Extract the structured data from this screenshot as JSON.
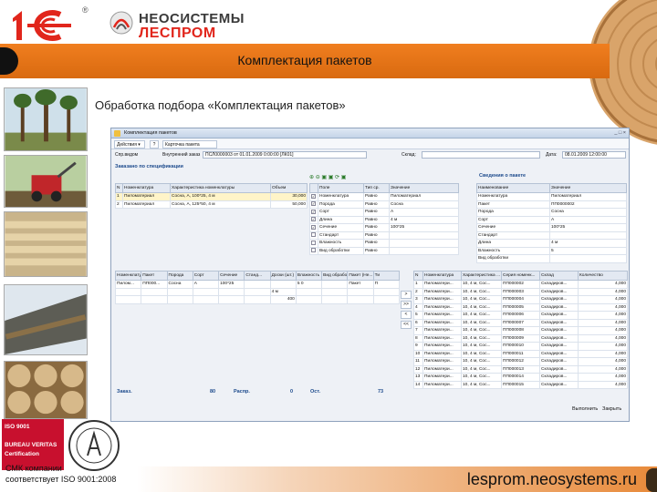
{
  "slide": {
    "title": "Комплектация пакетов",
    "subtitle": "Обработка подбора «Комплектация пакетов»",
    "reg_mark": "®",
    "company_line1": "НЕОСИСТЕМЫ",
    "company_line2": "ЛЕСПРОМ",
    "cert_line1": "ISO 9001",
    "cert_line2": "BUREAU VERITAS",
    "cert_line3": "Certification",
    "smk_line1": "СМК компании",
    "smk_line2": "соответствует ISO 9001:2008",
    "site": "lesprom.neosystems.ru",
    "accent": "#f07e1f",
    "logo_red": "#e1261c"
  },
  "app": {
    "window_title": "Комплектация пакетов",
    "toolbar": {
      "actions": "Действия ▾",
      "help": "?",
      "card": "Карточка пакета"
    },
    "filter": {
      "label": "Спр.видом",
      "doc_label": "Внутренний заказ",
      "doc_value": "ПСЛ0000003 от 01.01.2009 0:00:00 [ЛК01]",
      "warehouse_label": "Склад:",
      "date_label": "Дата:",
      "date_value": "08.01.2009 12:00:00"
    },
    "spec_title": "Заказано по спецификации",
    "spec_columns": [
      "N",
      "Номенклатура",
      "Характеристика номенклатуры",
      "Объем"
    ],
    "spec_rows": [
      [
        "1",
        "Пиломатериал",
        "Сосна, А, 100*25, 4 м",
        "30,000"
      ],
      [
        "2",
        "Пиломатериал",
        "Сосна, А, 125*50, 4 м",
        "50,000"
      ]
    ],
    "filter_columns": [
      "",
      "Поле",
      "Тип ср.",
      "Значение"
    ],
    "filter_rows": [
      [
        "✓",
        "Номенклатура",
        "Равно",
        "Пиломатериал"
      ],
      [
        "✓",
        "Порода",
        "Равно",
        "Сосна"
      ],
      [
        "✓",
        "Сорт",
        "Равно",
        "А"
      ],
      [
        "✓",
        "Длина",
        "Равно",
        "4 м"
      ],
      [
        "✓",
        "Сечение",
        "Равно",
        "100*25"
      ],
      [
        "",
        "Стандарт",
        "Равно",
        ""
      ],
      [
        "",
        "Влажность",
        "Равно",
        ""
      ],
      [
        "",
        "Вид обработки",
        "Равно",
        ""
      ]
    ],
    "pack_title": "Сведения о пакете",
    "pack_columns": [
      "Наименование",
      "Значение"
    ],
    "pack_rows": [
      [
        "Номенклатура",
        "Пиломатериал"
      ],
      [
        "Пакет",
        "ПП0000002"
      ],
      [
        "Порода",
        "Сосна"
      ],
      [
        "Сорт",
        "А"
      ],
      [
        "Сечение",
        "100*25"
      ],
      [
        "Стандарт",
        ""
      ],
      [
        "Длина",
        "4 м"
      ],
      [
        "Влажность",
        "5"
      ],
      [
        "Вид обработки",
        ""
      ]
    ],
    "sel_columns": [
      "Номенклатура",
      "Пакет",
      "Порода",
      "Сорт",
      "Сечение",
      "Станд...",
      "Доски (шт.)",
      "Влажность",
      "Вид обработки",
      "Пакет (Не...",
      "Ти"
    ],
    "sel_row": [
      "Пилом...",
      "ПП000...",
      "Сосна",
      "А",
      "100*25",
      "",
      "",
      "5 0",
      "",
      "Пакет",
      "П"
    ],
    "sel_len": "4 м",
    "sel_count": "400",
    "arrows": [
      ">",
      ">>",
      "<",
      "<<"
    ],
    "avail_columns": [
      "N",
      "Номенклатура",
      "Характеристика ...",
      "Серия номенк...",
      "Склад",
      "Количество"
    ],
    "avail_rows": [
      [
        "1",
        "Пиломатери...",
        "10, 4 м, Сос...",
        "ПП000002",
        "Складиров...",
        "4,000"
      ],
      [
        "2",
        "Пиломатери...",
        "10, 4 м, Сос...",
        "ПП000003",
        "Складиров...",
        "4,000"
      ],
      [
        "3",
        "Пиломатери...",
        "10, 4 м, Сос...",
        "ПП000004",
        "Складиров...",
        "4,000"
      ],
      [
        "4",
        "Пиломатери...",
        "10, 4 м, Сос...",
        "ПП000005",
        "Складиров...",
        "4,000"
      ],
      [
        "5",
        "Пиломатери...",
        "10, 4 м, Сос...",
        "ПП000006",
        "Складиров...",
        "4,000"
      ],
      [
        "6",
        "Пиломатери...",
        "10, 4 м, Сос...",
        "ПП000007",
        "Складиров...",
        "4,000"
      ],
      [
        "7",
        "Пиломатери...",
        "10, 4 м, Сос...",
        "ПП000008",
        "Складиров...",
        "4,000"
      ],
      [
        "8",
        "Пиломатери...",
        "10, 4 м, Сос...",
        "ПП000009",
        "Складиров...",
        "4,000"
      ],
      [
        "9",
        "Пиломатери...",
        "10, 4 м, Сос...",
        "ПП000010",
        "Складиров...",
        "4,000"
      ],
      [
        "10",
        "Пиломатери...",
        "10, 4 м, Сос...",
        "ПП000011",
        "Складиров...",
        "4,000"
      ],
      [
        "11",
        "Пиломатери...",
        "10, 4 м, Сос...",
        "ПП000012",
        "Складиров...",
        "4,000"
      ],
      [
        "12",
        "Пиломатери...",
        "10, 4 м, Сос...",
        "ПП000013",
        "Складиров...",
        "4,000"
      ],
      [
        "13",
        "Пиломатери...",
        "10, 4 м, Сос...",
        "ПП000014",
        "Складиров...",
        "4,000"
      ],
      [
        "14",
        "Пиломатери...",
        "10, 4 м, Сос...",
        "ПП000015",
        "Складиров...",
        "4,000"
      ]
    ],
    "totals": {
      "ordered_label": "Заказ.",
      "ordered": "80",
      "distributed_label": "Распр.",
      "distributed": "0",
      "remainder_label": "Ост.",
      "remainder": "73"
    },
    "run_button": "Выполнить",
    "close_button": "Закрыть"
  }
}
